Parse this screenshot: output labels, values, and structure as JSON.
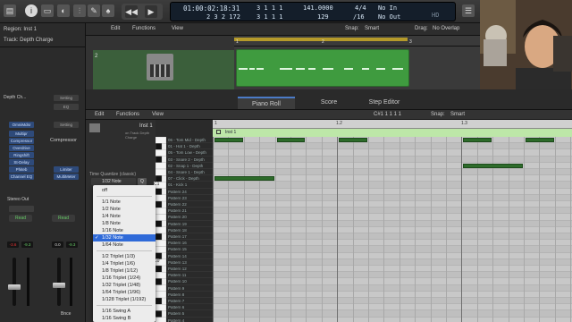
{
  "toolbar": {
    "lcd_time": "01:00:02:18:31",
    "lcd_bars": "2 3 2 172",
    "lcd_sub1": "3 1 1 1",
    "lcd_sub2": "3 1 1 1",
    "lcd_tempo": "141.0000",
    "lcd_tempo2": "129",
    "lcd_sig": "4/4",
    "lcd_div": "/16",
    "lcd_in": "No In",
    "lcd_out": "No Out",
    "lcd_hd": "HD"
  },
  "inspector": {
    "region": "Region: Inst 1",
    "track": "Track: Depth Charge",
    "channel_left_name": "Depth Ch...",
    "channel_right_name": "Compressor",
    "setting_left": "Setting",
    "setting_right": "Setting",
    "eq_label": "EQ",
    "midi_fx": "OmniMdsr",
    "plugins_left": [
      "Multipr",
      "Compressor",
      "Overdrive",
      "Ringshift",
      "St-Delay",
      "Phiteb",
      "Channel EQ"
    ],
    "plugins_right": [
      "Limiter",
      "MultiMeter"
    ],
    "output": "Stereo Out",
    "read_left": "Read",
    "read_right": "Read",
    "vol_left_a": "-3.6",
    "vol_left_b": "-9.3",
    "vol_right_a": "0.0",
    "vol_right_b": "-9.3",
    "bnce": "Bnce"
  },
  "tracks": {
    "menus": [
      "Edit",
      "Functions",
      "View"
    ],
    "snap_label": "Snap:",
    "snap_value": "Smart",
    "drag_label": "Drag:",
    "drag_value": "No Overlap",
    "track_number": "2",
    "ruler": [
      "1",
      "2",
      "3"
    ]
  },
  "tabs": [
    "Piano Roll",
    "Score",
    "Step Editor"
  ],
  "piano_roll": {
    "menus": [
      "Edit",
      "Functions",
      "View"
    ],
    "position": "C#1  1 1 1 1",
    "snap_label": "Snap:",
    "snap_value": "Smart",
    "region_name": "Inst 1",
    "region_sub": "on Track Depth Charge",
    "quantize_label": "Time Quantize (classic)",
    "quantize_value": "1/32 Note",
    "quantize_q": "Q",
    "ruler": [
      "1",
      "1.2",
      "1.3"
    ],
    "green_label": "Inst 1",
    "octave_c1": "C1",
    "octave_c0": "C0",
    "lanes": [
      "06 - Tom Mid - Depth",
      "01 - Hat 1 - Depth",
      "05 - Tom Low - Depth",
      "03 - Snare 2 - Depth",
      "02 - Snap 1 - Depth",
      "04 - Snare 1 - Depth",
      "07 - Click - Depth",
      "01 - Kick 1",
      "Pattern 24",
      "Pattern 23",
      "Pattern 22",
      "Pattern 21",
      "Pattern 20",
      "Pattern 19",
      "Pattern 18",
      "Pattern 17",
      "Pattern 16",
      "Pattern 15",
      "Pattern 14",
      "Pattern 13",
      "Pattern 12",
      "Pattern 11",
      "Pattern 10",
      "Pattern 9",
      "Pattern 8",
      "Pattern 7",
      "Pattern 6",
      "Pattern 5",
      "Pattern 4"
    ]
  },
  "dropdown": {
    "items": [
      "off",
      "1/1 Note",
      "1/2 Note",
      "1/4 Note",
      "1/8 Note",
      "1/16 Note",
      "1/32 Note",
      "1/64 Note",
      "1/2 Triplet (1/3)",
      "1/4 Triplet (1/6)",
      "1/8 Triplet (1/12)",
      "1/16 Triplet (1/24)",
      "1/32 Triplet (1/48)",
      "1/64 Triplet (1/96)",
      "1/128 Triplet (1/192)",
      "1/16 Swing A",
      "1/16 Swing B"
    ],
    "selected": "1/32 Note",
    "check": "✓"
  }
}
